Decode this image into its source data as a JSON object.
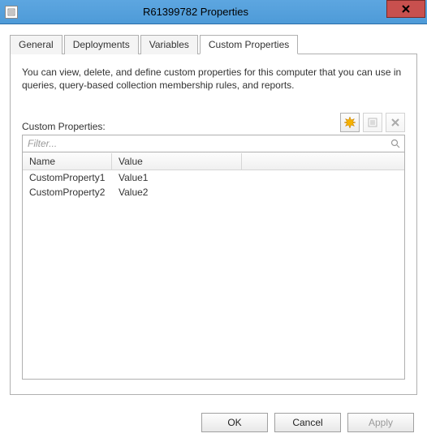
{
  "window": {
    "title": "R61399782 Properties"
  },
  "tabs": [
    {
      "label": "General"
    },
    {
      "label": "Deployments"
    },
    {
      "label": "Variables"
    },
    {
      "label": "Custom Properties"
    }
  ],
  "description": "You can view, delete, and define custom properties for this computer that you can use in queries, query-based collection membership rules, and reports.",
  "section_label": "Custom Properties:",
  "filter": {
    "placeholder": "Filter..."
  },
  "columns": {
    "name": "Name",
    "value": "Value"
  },
  "rows": [
    {
      "name": "CustomProperty1",
      "value": "Value1"
    },
    {
      "name": "CustomProperty2",
      "value": "Value2"
    }
  ],
  "buttons": {
    "ok": "OK",
    "cancel": "Cancel",
    "apply": "Apply"
  }
}
